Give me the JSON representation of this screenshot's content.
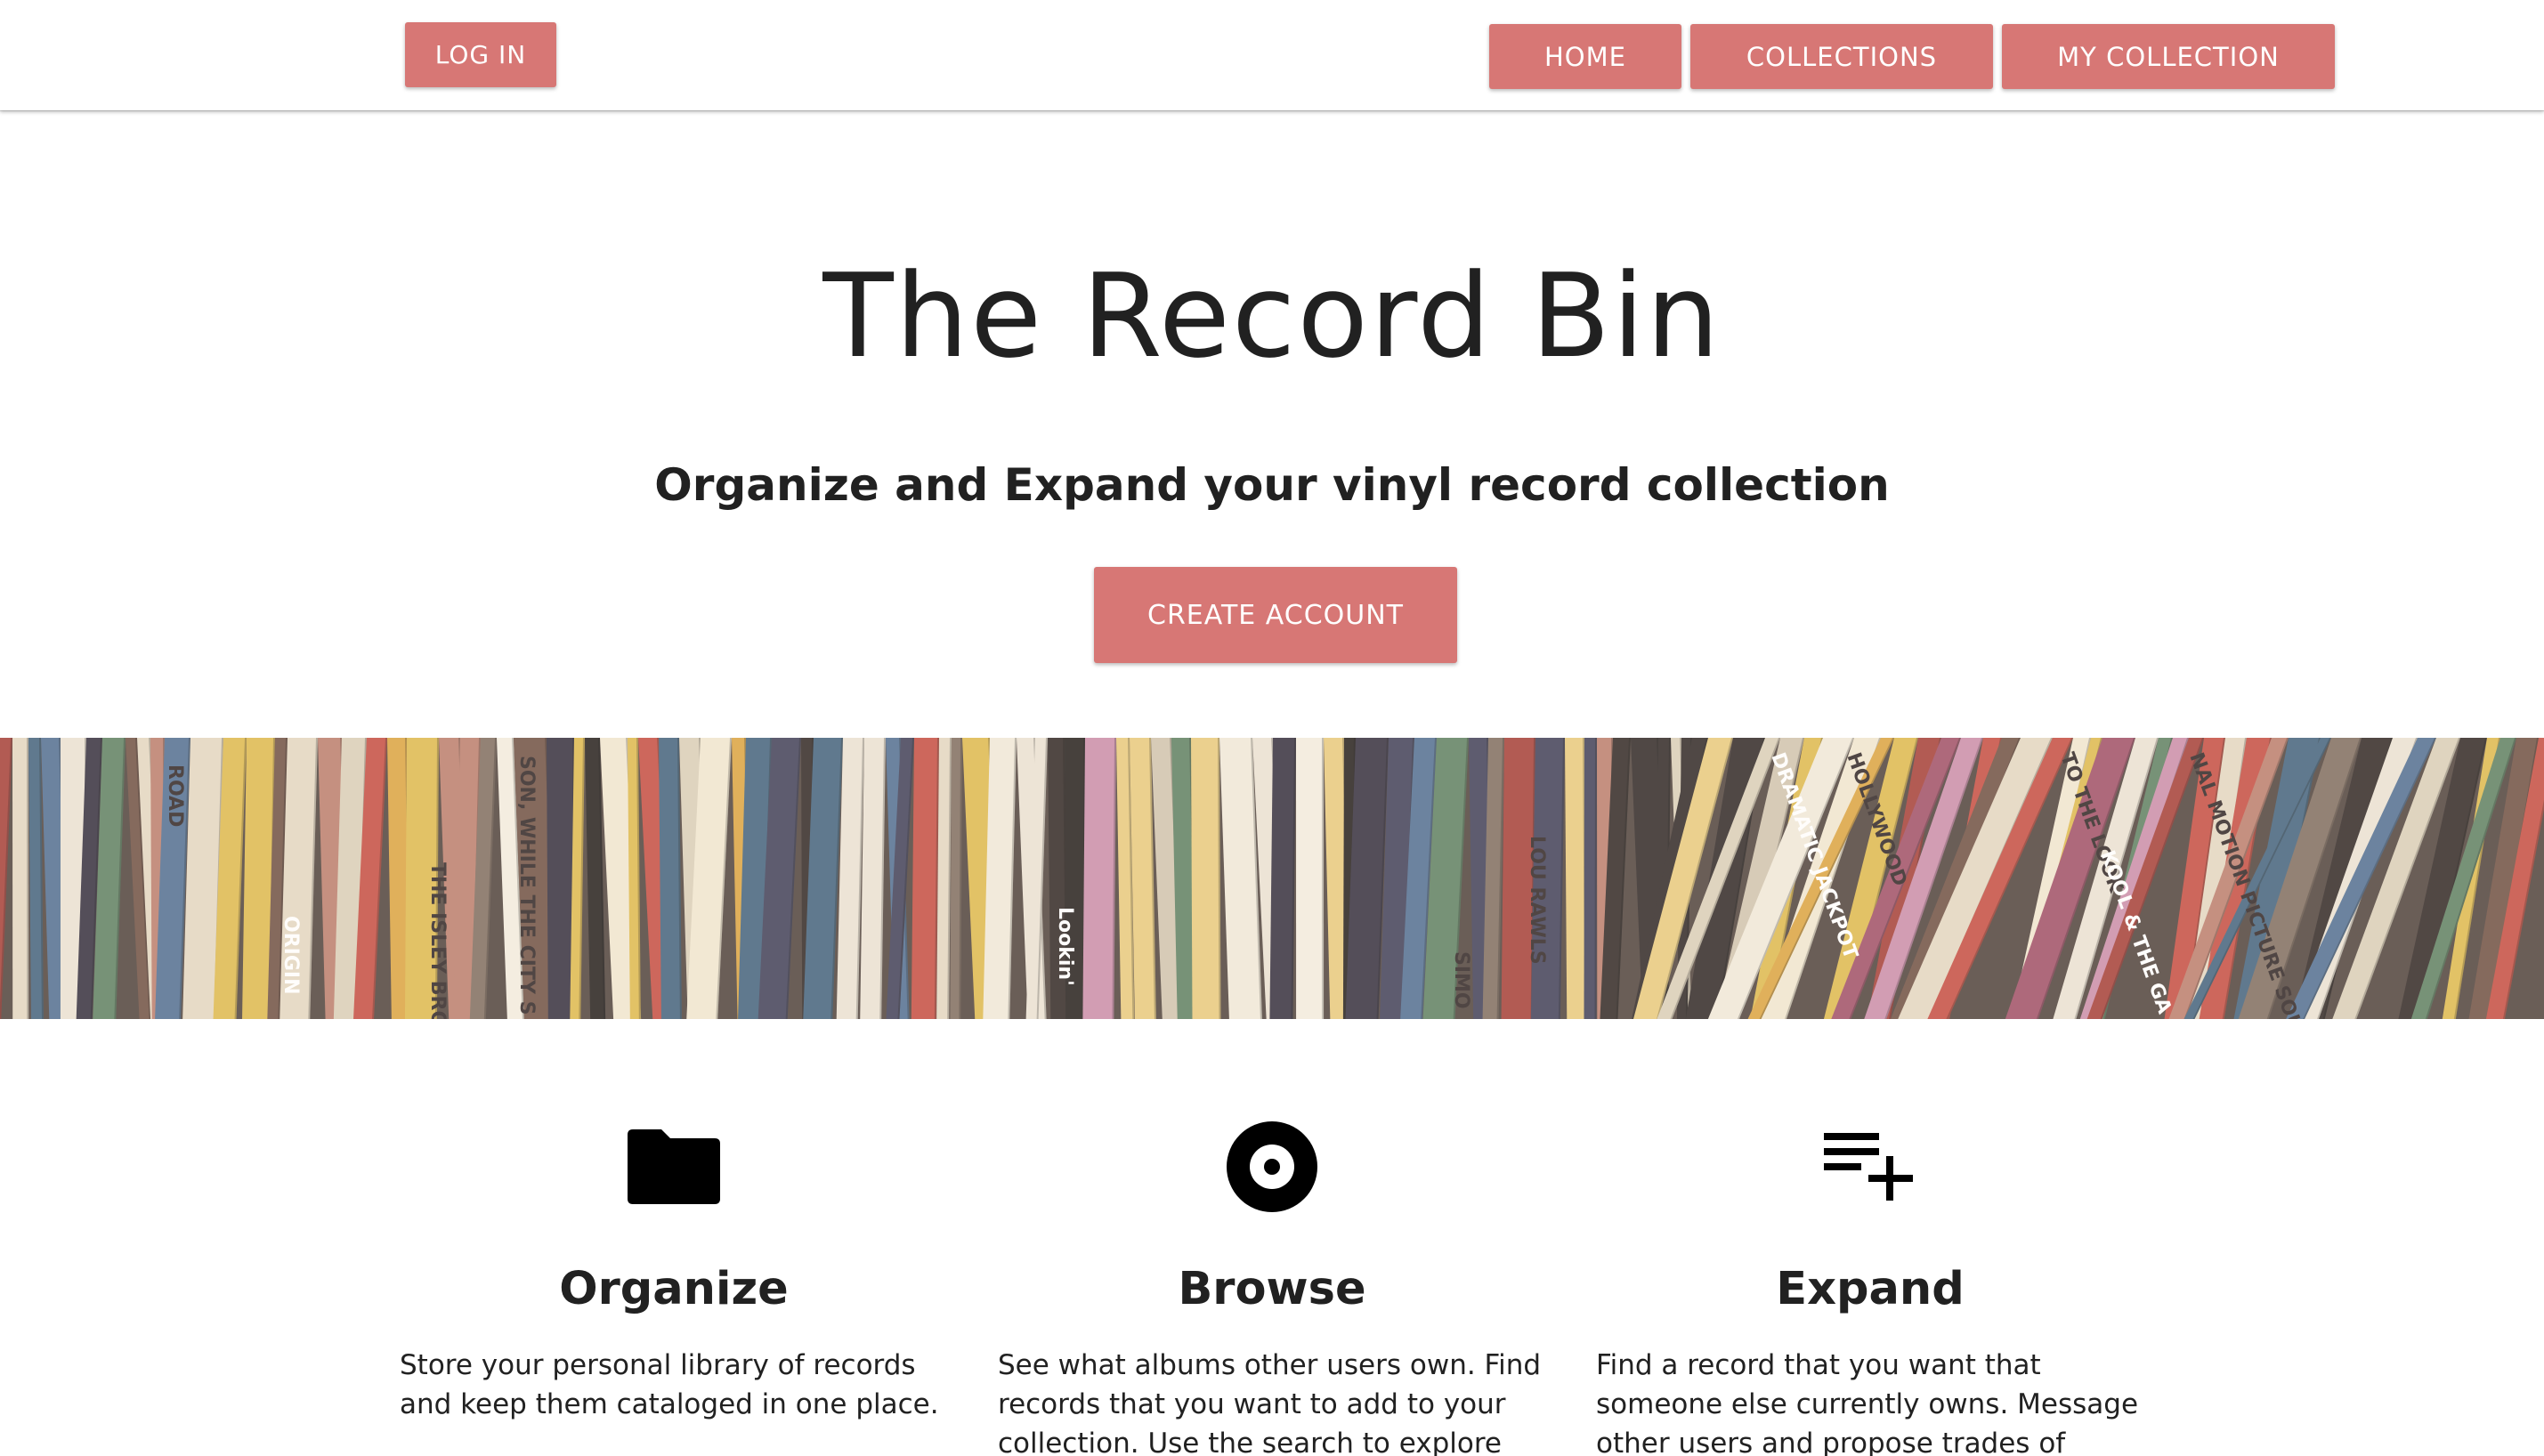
{
  "nav": {
    "login_label": "LOG IN",
    "home_label": "HOME",
    "collections_label": "COLLECTIONS",
    "my_collection_label": "MY COLLECTION"
  },
  "hero": {
    "title": "The Record Bin",
    "subtitle": "Organize and Expand your vinyl record collection",
    "cta_label": "CREATE ACCOUNT"
  },
  "banner": {
    "spine_texts": [
      "ROAD",
      "ORIGIN",
      "THE ISLEY BRO",
      "SON, WHILE THE CITY S",
      "Lookin'",
      "LOU RAWLS",
      "SIMO",
      "DRAMATIC JACKPOT",
      "HOLLYWOOD",
      "TO THE LOOK",
      "KOOL & THE GA",
      "NAL MOTION PICTURE SOUN"
    ]
  },
  "features": [
    {
      "icon": "folder-icon",
      "title": "Organize",
      "text": "Store your personal library of records and keep them cataloged in one place."
    },
    {
      "icon": "album-icon",
      "title": "Browse",
      "text": "See what albums other users own. Find records that you want to add to your collection. Use the search to explore"
    },
    {
      "icon": "playlist-add-icon",
      "title": "Expand",
      "text": "Find a record that you want that someone else currently owns. Message other users and propose trades of albums"
    }
  ],
  "colors": {
    "accent": "#d77775",
    "text": "#212121",
    "background": "#ffffff"
  }
}
